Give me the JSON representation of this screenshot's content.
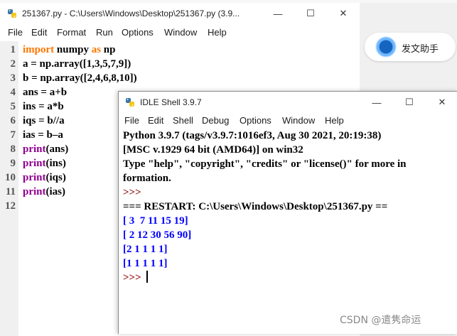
{
  "editor": {
    "title": "251367.py - C:\\Users\\Windows\\Desktop\\251367.py (3.9...",
    "menu": [
      "File",
      "Edit",
      "Format",
      "Run",
      "Options",
      "Window",
      "Help"
    ],
    "line_numbers": [
      "1",
      "2",
      "3",
      "4",
      "5",
      "6",
      "7",
      "8",
      "9",
      "10",
      "11",
      "12"
    ],
    "code_lines": [
      [
        {
          "t": "import",
          "c": "kw"
        },
        {
          "t": " numpy ",
          "c": "plain"
        },
        {
          "t": "as",
          "c": "kw"
        },
        {
          "t": " np",
          "c": "plain"
        }
      ],
      [
        {
          "t": "a = np.array([1,3,5,7,9])",
          "c": "plain"
        }
      ],
      [
        {
          "t": "b = np.array([2,4,6,8,10])",
          "c": "plain"
        }
      ],
      [
        {
          "t": "ans = a+b",
          "c": "plain"
        }
      ],
      [
        {
          "t": "ins = a*b",
          "c": "plain"
        }
      ],
      [
        {
          "t": "iqs = b//a",
          "c": "plain"
        }
      ],
      [
        {
          "t": "ias = b–a",
          "c": "plain"
        }
      ],
      [
        {
          "t": "print",
          "c": "bi"
        },
        {
          "t": "(ans)",
          "c": "plain"
        }
      ],
      [
        {
          "t": "print",
          "c": "bi"
        },
        {
          "t": "(ins)",
          "c": "plain"
        }
      ],
      [
        {
          "t": "print",
          "c": "bi"
        },
        {
          "t": "(iqs)",
          "c": "plain"
        }
      ],
      [
        {
          "t": "print",
          "c": "bi"
        },
        {
          "t": "(ias)",
          "c": "plain"
        }
      ],
      []
    ]
  },
  "side_app": {
    "send_label": "发文助手"
  },
  "shell": {
    "title": "IDLE Shell 3.9.7",
    "menu": [
      "File",
      "Edit",
      "Shell",
      "Debug",
      "Options",
      "Window",
      "Help"
    ],
    "lines": [
      {
        "t": "Python 3.9.7 (tags/v3.9.7:1016ef3, Aug 30 2021, 20:19:38)",
        "c": "plain"
      },
      {
        "t": "[MSC v.1929 64 bit (AMD64)] on win32",
        "c": "plain"
      },
      {
        "t": "Type \"help\", \"copyright\", \"credits\" or \"license()\" for more in",
        "c": "plain"
      },
      {
        "t": "formation.",
        "c": "plain"
      },
      {
        "t": ">>>",
        "c": "prompt"
      },
      {
        "t": "=== RESTART: C:\\Users\\Windows\\Desktop\\251367.py ==",
        "c": "plain"
      },
      {
        "t": "[ 3  7 11 15 19]",
        "c": "out"
      },
      {
        "t": "[ 2 12 30 56 90]",
        "c": "out"
      },
      {
        "t": "[2 1 1 1 1]",
        "c": "out"
      },
      {
        "t": "[1 1 1 1 1]",
        "c": "out"
      },
      {
        "t": ">>> ",
        "c": "prompt"
      }
    ]
  },
  "watermark": "CSDN @遣隽命运",
  "colors": {
    "keyword": "#ff7700",
    "builtin": "#900090",
    "output": "#0000ff",
    "prompt": "#8b0000"
  }
}
